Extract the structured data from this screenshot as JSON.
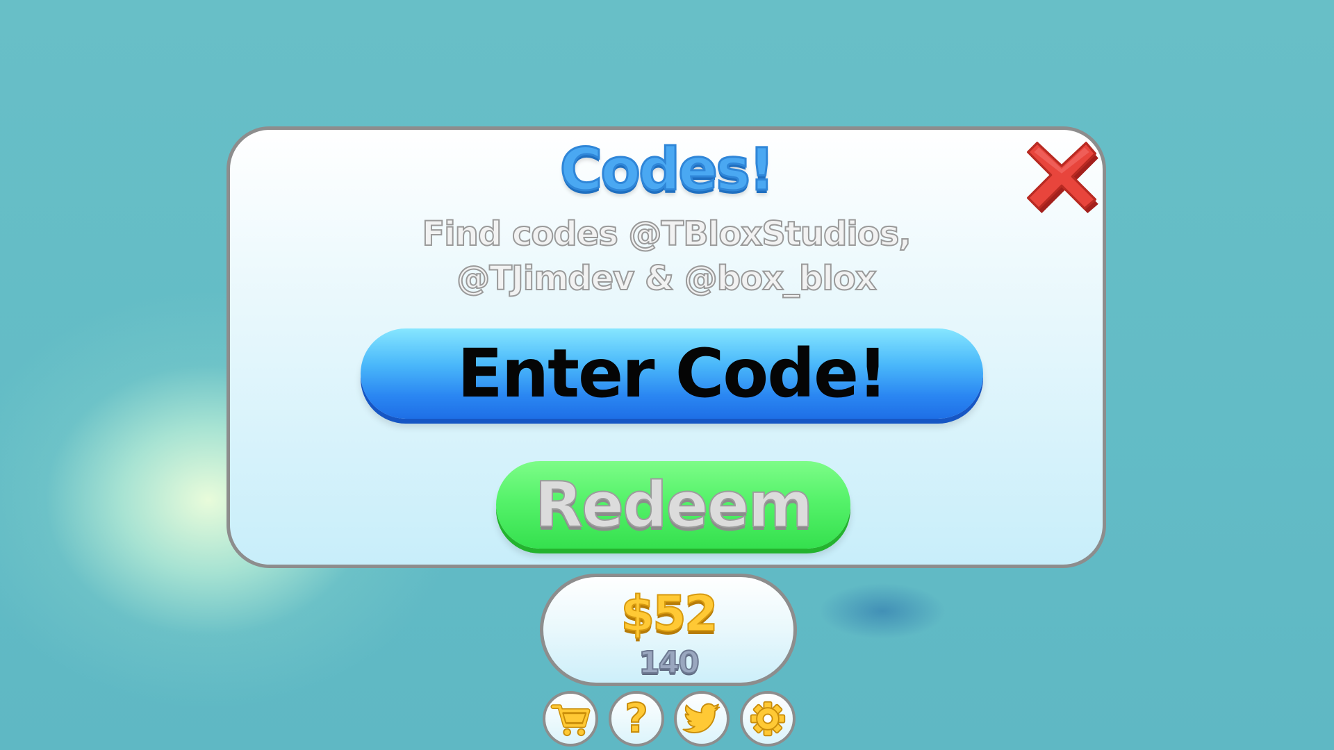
{
  "codes_modal": {
    "title": "Codes!",
    "subtitle_line1": "Find codes @TBloxStudios,",
    "subtitle_line2": "@TJimdev &  @box_blox",
    "input_label": "Enter Code!",
    "redeem_label": "Redeem",
    "close_icon": "close-x-icon"
  },
  "currency": {
    "cash": "$52",
    "secondary": "140"
  },
  "menu_buttons": [
    {
      "icon": "shopping-cart-icon"
    },
    {
      "icon": "question-mark-icon",
      "glyph": "?"
    },
    {
      "icon": "twitter-bird-icon"
    },
    {
      "icon": "gear-icon"
    }
  ],
  "colors": {
    "title_blue": "#4aa8f2",
    "close_red": "#e8453c",
    "input_blue": "#2a86f2",
    "redeem_green": "#48ea5e",
    "cash_gold": "#ffc935",
    "panel_border": "#8d8d8d"
  }
}
